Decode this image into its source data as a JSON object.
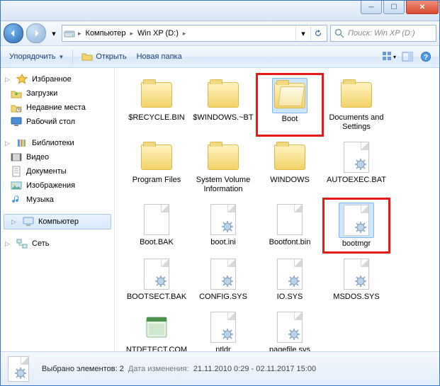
{
  "breadcrumb": {
    "root": "Компьютер",
    "drive": "Win XP (D:)"
  },
  "search": {
    "placeholder": "Поиск: Win XP (D:)"
  },
  "toolbar": {
    "organize": "Упорядочить",
    "open": "Открыть",
    "newfolder": "Новая папка"
  },
  "sidebar": {
    "favorites": {
      "label": "Избранное",
      "items": [
        "Загрузки",
        "Недавние места",
        "Рабочий стол"
      ]
    },
    "libraries": {
      "label": "Библиотеки",
      "items": [
        "Видео",
        "Документы",
        "Изображения",
        "Музыка"
      ]
    },
    "computer": "Компьютер",
    "network": "Сеть"
  },
  "items": [
    {
      "name": "$RECYCLE.BIN",
      "type": "folder"
    },
    {
      "name": "$WINDOWS.~BT",
      "type": "folder"
    },
    {
      "name": "Boot",
      "type": "folder",
      "selected": true,
      "highlight": true
    },
    {
      "name": "Documents and Settings",
      "type": "folder"
    },
    {
      "name": "Program Files",
      "type": "folder"
    },
    {
      "name": "System Volume Information",
      "type": "folder"
    },
    {
      "name": "WINDOWS",
      "type": "folder"
    },
    {
      "name": "AUTOEXEC.BAT",
      "type": "sys"
    },
    {
      "name": "Boot.BAK",
      "type": "file"
    },
    {
      "name": "boot.ini",
      "type": "sys"
    },
    {
      "name": "Bootfont.bin",
      "type": "file"
    },
    {
      "name": "bootmgr",
      "type": "sys",
      "selected": true,
      "highlight": true
    },
    {
      "name": "BOOTSECT.BAK",
      "type": "sys"
    },
    {
      "name": "CONFIG.SYS",
      "type": "sys"
    },
    {
      "name": "IO.SYS",
      "type": "sys"
    },
    {
      "name": "MSDOS.SYS",
      "type": "sys"
    },
    {
      "name": "NTDETECT.COM",
      "type": "app"
    },
    {
      "name": "ntldr",
      "type": "sys"
    },
    {
      "name": "pagefile.sys",
      "type": "sys"
    }
  ],
  "status": {
    "selected_label": "Выбрано элементов: 2",
    "date_label": "Дата изменения:",
    "date_value": "21.11.2010 0:29 - 02.11.2017 15:00"
  }
}
